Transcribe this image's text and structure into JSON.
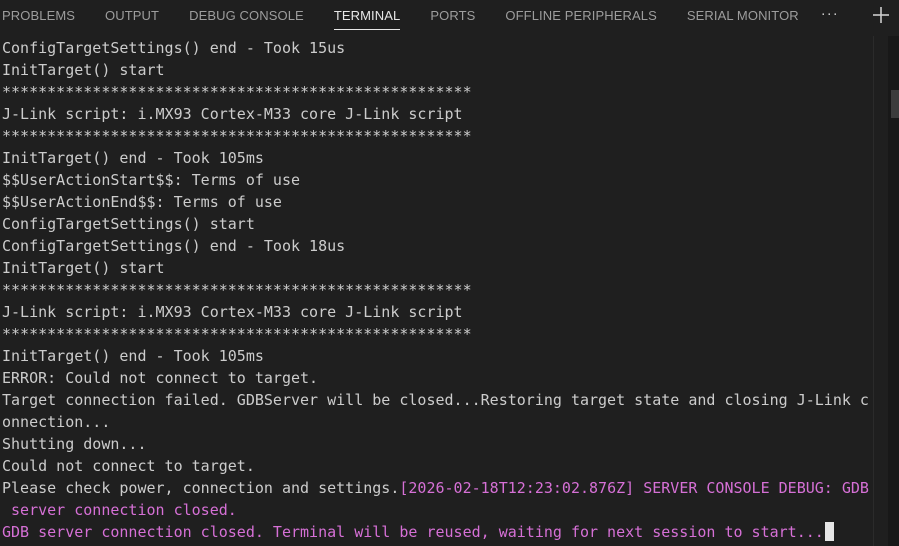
{
  "tabs": [
    {
      "label": "PROBLEMS",
      "active": false
    },
    {
      "label": "OUTPUT",
      "active": false
    },
    {
      "label": "DEBUG CONSOLE",
      "active": false
    },
    {
      "label": "TERMINAL",
      "active": true
    },
    {
      "label": "PORTS",
      "active": false
    },
    {
      "label": "OFFLINE PERIPHERALS",
      "active": false
    },
    {
      "label": "SERIAL MONITOR",
      "active": false
    }
  ],
  "more_label": "···",
  "icons": {
    "more": "ellipsis-icon",
    "new_terminal": "plus-icon"
  },
  "colors": {
    "background": "#1f1f1f",
    "text": "#cccccc",
    "magenta": "#d670d6"
  },
  "terminal": {
    "lines": [
      "ConfigTargetSettings() end - Took 15us",
      "InitTarget() start",
      "****************************************************",
      "J-Link script: i.MX93 Cortex-M33 core J-Link script",
      "****************************************************",
      "InitTarget() end - Took 105ms",
      "$$UserActionStart$$: Terms of use",
      "$$UserActionEnd$$: Terms of use",
      "ConfigTargetSettings() start",
      "ConfigTargetSettings() end - Took 18us",
      "InitTarget() start",
      "****************************************************",
      "J-Link script: i.MX93 Cortex-M33 core J-Link script",
      "****************************************************",
      "InitTarget() end - Took 105ms",
      "ERROR: Could not connect to target.",
      "Target connection failed. GDBServer will be closed...Restoring target state and closing J-Link c",
      "onnection...",
      "Shutting down...",
      "Could not connect to target."
    ],
    "check_line_plain": "Please check power, connection and settings.",
    "check_line_pink": "[2026-02-18T12:23:02.876Z] SERVER CONSOLE DEBUG: GDB",
    "pink_continuation": " server connection closed.",
    "final_line": "GDB server connection closed. Terminal will be reused, waiting for next session to start..."
  }
}
